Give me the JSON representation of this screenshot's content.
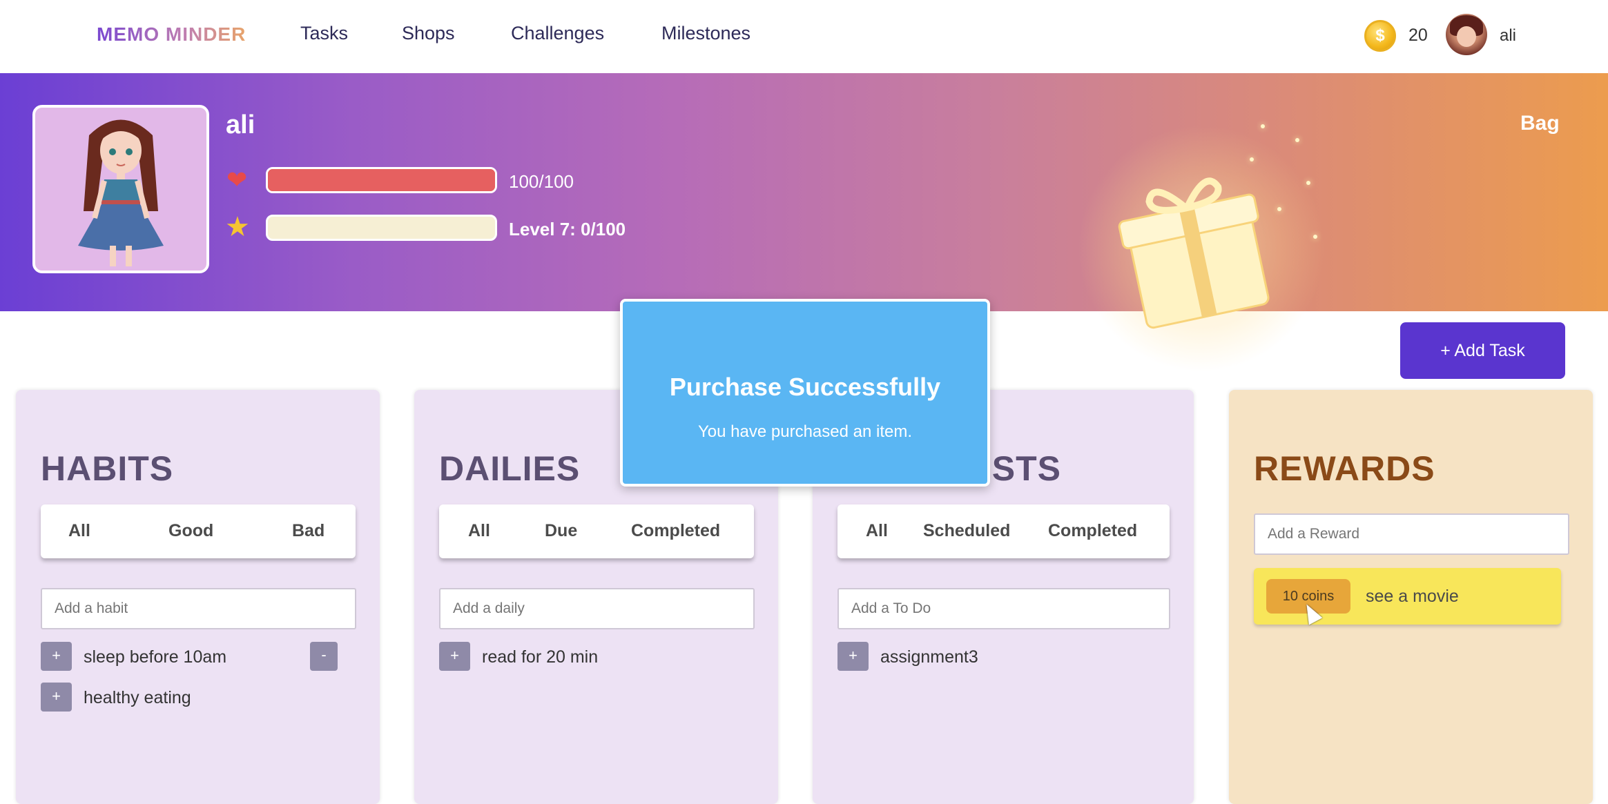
{
  "nav": {
    "brand": "MEMO MINDER",
    "links": [
      "Tasks",
      "Shops",
      "Challenges",
      "Milestones"
    ],
    "coin_symbol": "$",
    "coins": "20",
    "username": "ali"
  },
  "banner": {
    "name": "ali",
    "hp_text": "100/100",
    "hp_fraction": 1.0,
    "xp_text": "Level 7: 0/100",
    "xp_fraction": 0.0,
    "bag_label": "Bag"
  },
  "add_task_label": "+ Add Task",
  "columns": {
    "habits": {
      "title": "HABITS",
      "filters": [
        "All",
        "Good",
        "Bad"
      ],
      "placeholder": "Add a habit",
      "items": [
        {
          "label": "sleep before 10am",
          "plus": "+",
          "minus": "-"
        },
        {
          "label": "healthy eating",
          "plus": "+"
        }
      ]
    },
    "dailies": {
      "title": "DAILIES",
      "filters": [
        "All",
        "Due",
        "Completed"
      ],
      "placeholder": "Add a daily",
      "items": [
        {
          "label": "read for 20 min",
          "plus": "+"
        }
      ]
    },
    "todos": {
      "title": "TO DO LISTS",
      "filters": [
        "All",
        "Scheduled",
        "Completed"
      ],
      "placeholder": "Add a To Do",
      "items": [
        {
          "label": "assignment3",
          "plus": "+"
        }
      ]
    },
    "rewards": {
      "title": "REWARDS",
      "placeholder": "Add a Reward",
      "items": [
        {
          "cost": "10 coins",
          "label": "see a movie"
        }
      ]
    }
  },
  "modal": {
    "title": "Purchase Successfully",
    "body": "You have purchased an item."
  },
  "colors": {
    "accent": "#5a35cf",
    "modal": "#5ab6f3",
    "hp": "#e66060",
    "reward_card": "#f8e65a"
  }
}
